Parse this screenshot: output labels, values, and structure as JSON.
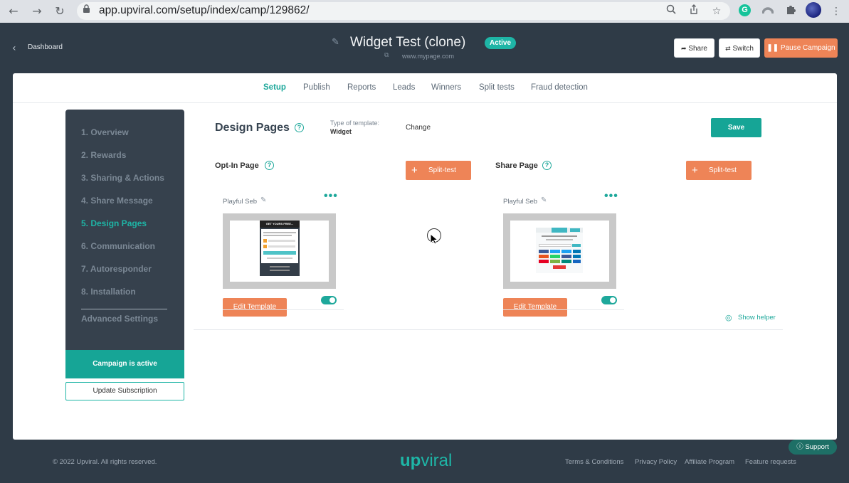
{
  "browser": {
    "url": "app.upviral.com/setup/index/camp/129862/",
    "back_icon": "arrow-left-icon",
    "forward_icon": "arrow-right-icon",
    "reload_icon": "reload-icon",
    "ext_g_letter": "G"
  },
  "header": {
    "dashboard_label": "Dashboard",
    "title": "Widget Test (clone)",
    "status": "Active",
    "domain": "www.mypage.com",
    "share_label": "Share",
    "switch_label": "Switch",
    "pause_label": "Pause Campaign"
  },
  "tabs": [
    {
      "label": "Setup"
    },
    {
      "label": "Publish"
    },
    {
      "label": "Reports"
    },
    {
      "label": "Leads"
    },
    {
      "label": "Winners"
    },
    {
      "label": "Split tests"
    },
    {
      "label": "Fraud detection"
    }
  ],
  "sidebar": {
    "steps": [
      {
        "label": "1. Overview"
      },
      {
        "label": "2. Rewards"
      },
      {
        "label": "3. Sharing & Actions"
      },
      {
        "label": "4. Share Message"
      },
      {
        "label": "5. Design Pages"
      },
      {
        "label": "6. Communication"
      },
      {
        "label": "7. Autoresponder"
      },
      {
        "label": "8. Installation"
      }
    ],
    "advanced": "Advanced Settings",
    "campaign_status": "Campaign is active",
    "update_subscription": "Update Subscription"
  },
  "content": {
    "title": "Design Pages",
    "help_glyph": "?",
    "type_label": "Type of template:",
    "type_value": "Widget",
    "change_label": "Change",
    "save_label": "Save",
    "optin": {
      "title": "Opt-In Page",
      "split_label": "Split-test",
      "template_name": "Playful Seb",
      "edit_label": "Edit Template",
      "preview_heading": "GET YOURS FREE..."
    },
    "share": {
      "title": "Share Page",
      "split_label": "Split-test",
      "template_name": "Playful Seb",
      "edit_label": "Edit Template"
    },
    "show_helper": "Show helper"
  },
  "footer": {
    "copyright": "© 2022 Upviral. All rights reserved.",
    "logo_up": "up",
    "logo_viral": "viral",
    "links": [
      "Terms & Conditions",
      "Privacy Policy",
      "Affiliate Program",
      "Feature requests"
    ],
    "support_label": "Support"
  },
  "colors": {
    "accent": "#1eb5a6",
    "orange": "#ee8457",
    "sidebar_bg": "#36414d",
    "page_bg": "#2f3b47"
  }
}
